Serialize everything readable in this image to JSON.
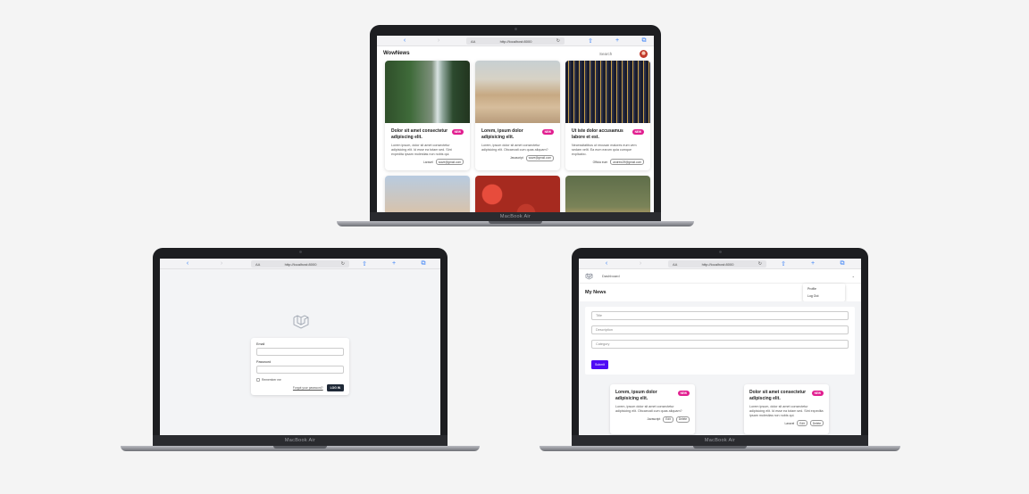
{
  "device_label": "MacBook Air",
  "browser": {
    "aa": "AA",
    "url": "http://localhost:8000",
    "icons": [
      "back-icon",
      "forward-icon",
      "bookmarks-icon",
      "share-icon",
      "new-tab-icon",
      "tabs-icon"
    ]
  },
  "home": {
    "brand": "WowNews",
    "search_placeholder": "Search",
    "cards": [
      {
        "title": "Dolor sit amet consectetur adipiscing elit.",
        "badge": "NEW",
        "description": "Lorem ipsum, dolor sit amet consectetur adipisicing elit. Id esse ea totam sed. Sint expedita ipsam molestias non nobis qui.",
        "category": "Laravel",
        "author": "wave@gmail.com"
      },
      {
        "title": "Lorem, ipsum dolor adipisicing elit.",
        "badge": "NEW",
        "description": "Lorem, ipsum dolor sit amet consectetur adipisicing elit. Obcaecati cum quas aliquam?",
        "category": "Javascript",
        "author": "wave@gmail.com"
      },
      {
        "title": "Ut iste dolor accusamus labore et est.",
        "badge": "NEW",
        "description": "Necessitatibus ut recusan maiores eum vem sedam velit. Ea eum earum quia cumque explicabo.",
        "category": "Officia eum",
        "author": "andrew29@gmail.com"
      }
    ]
  },
  "login": {
    "email_label": "Email",
    "password_label": "Password",
    "remember_label": "Remember me",
    "forgot_label": "Forgot your password?",
    "login_button": "LOG IN"
  },
  "dashboard": {
    "nav_link": "Dashboard",
    "dropdown_items": [
      "Profile",
      "Log Out"
    ],
    "heading": "My News",
    "form": {
      "title_placeholder": "Title",
      "description_placeholder": "Description",
      "category_placeholder": "Category",
      "submit_label": "Submit"
    },
    "cards": [
      {
        "title": "Lorem, ipsum dolor adipisicing elit.",
        "badge": "NEW",
        "description": "Lorem, ipsum dolor sit amet consectetur adipisicing elit. Obcaecati cum quas aliquam?",
        "category": "Javascript",
        "edit_label": "Edit",
        "delete_label": "Delete"
      },
      {
        "title": "Dolor sit amet consectetur adipiscing elit.",
        "badge": "NEW",
        "description": "Lorem ipsum, dolor sit amet consectetur adipisicing elit. Id esse ea totam sed. Sint expedita ipsam molestias non nobis qui.",
        "category": "Laravel",
        "edit_label": "Edit",
        "delete_label": "Delete"
      }
    ]
  }
}
